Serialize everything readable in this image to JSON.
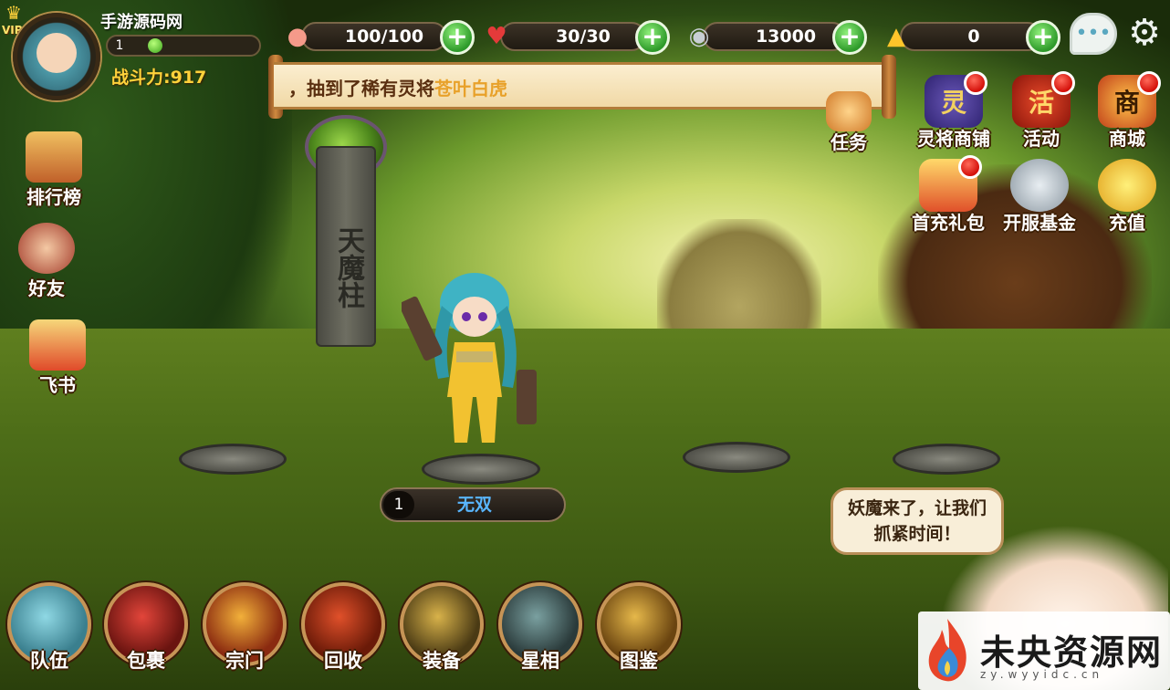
{
  "player": {
    "vip": "VIP 0",
    "name": "手游源码网",
    "level": "1",
    "power_label": "战斗力:",
    "power_value": "917"
  },
  "resources": [
    {
      "icon": "peach-icon",
      "value": "100/100"
    },
    {
      "icon": "heart-icon",
      "value": "30/30"
    },
    {
      "icon": "silver-coin-icon",
      "value": "13000"
    },
    {
      "icon": "gold-ingot-icon",
      "value": "0"
    }
  ],
  "notice": {
    "prefix": "，抽到了稀有灵将",
    "highlight": "苍叶白虎"
  },
  "left_menu": [
    {
      "label": "排行榜",
      "icon": "leaderboard-icon"
    },
    {
      "label": "好友",
      "icon": "friend-icon"
    },
    {
      "label": "飞书",
      "icon": "letter-icon"
    }
  ],
  "top_right_menu": [
    {
      "label": "任务",
      "icon": "task-icon",
      "glyph": "",
      "badge": false
    },
    {
      "label": "灵将商铺",
      "icon": "spirit-shop-icon",
      "glyph": "灵",
      "badge": true
    },
    {
      "label": "活动",
      "icon": "event-icon",
      "glyph": "活",
      "badge": true
    },
    {
      "label": "商城",
      "icon": "mall-icon",
      "glyph": "商",
      "badge": true
    },
    {
      "label": "首充礼包",
      "icon": "gift-box-icon",
      "glyph": "",
      "badge": true
    },
    {
      "label": "开服基金",
      "icon": "fund-coins-icon",
      "glyph": "",
      "badge": false
    },
    {
      "label": "充值",
      "icon": "recharge-ingot-icon",
      "glyph": "",
      "badge": false
    }
  ],
  "scene": {
    "pillar_text": "天魔柱"
  },
  "hero": {
    "level": "1",
    "name": "无双"
  },
  "speech": "妖魔来了，让我们抓紧时间！",
  "bottom_menu": [
    {
      "label": "队伍",
      "icon": "team-icon"
    },
    {
      "label": "包裹",
      "icon": "bag-icon"
    },
    {
      "label": "宗门",
      "icon": "sect-icon"
    },
    {
      "label": "回收",
      "icon": "recycle-icon"
    },
    {
      "label": "装备",
      "icon": "equipment-icon"
    },
    {
      "label": "星相",
      "icon": "astrology-icon"
    },
    {
      "label": "图鉴",
      "icon": "codex-icon"
    }
  ],
  "watermark": {
    "title": "未央资源网",
    "url": "zy.wyyidc.cn"
  },
  "colors": {
    "accent_gold": "#ffd23b",
    "hero_name_blue": "#59b6ff",
    "notice_highlight": "#e8a12a",
    "badge_red": "#d4100a",
    "plus_green": "#2e9a2a"
  }
}
